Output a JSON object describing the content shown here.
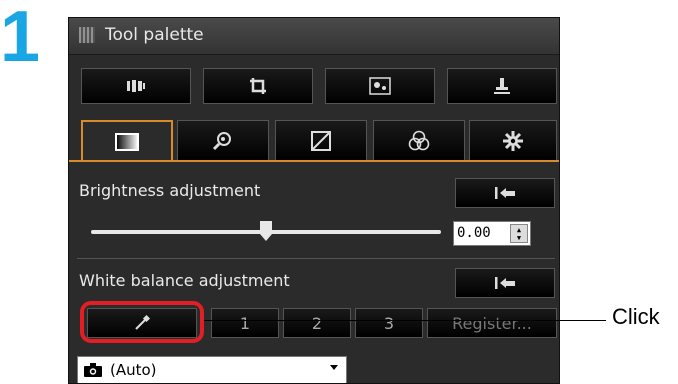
{
  "step_number": "1",
  "palette": {
    "title": "Tool palette",
    "toolbar": [
      {
        "icon": "compare-icon"
      },
      {
        "icon": "crop-icon"
      },
      {
        "icon": "dust-delete-icon"
      },
      {
        "icon": "stamp-icon"
      }
    ],
    "tabs": [
      {
        "icon": "basic-adjust-icon",
        "active": true
      },
      {
        "icon": "detail-icon",
        "active": false
      },
      {
        "icon": "tone-curve-icon",
        "active": false
      },
      {
        "icon": "color-icon",
        "active": false
      },
      {
        "icon": "settings-icon",
        "active": false
      }
    ],
    "brightness": {
      "label": "Brightness adjustment",
      "value": "0.00",
      "slider_fraction": 0.5
    },
    "white_balance": {
      "label": "White balance adjustment",
      "buttons": [
        "1",
        "2",
        "3"
      ],
      "register_label": "Register...",
      "preset_value": "(Auto)"
    }
  },
  "callout": {
    "text": "Click",
    "color": "#e31e24"
  },
  "colors": {
    "accent_orange": "#d98a2b",
    "step_blue": "#1aa6e4"
  }
}
